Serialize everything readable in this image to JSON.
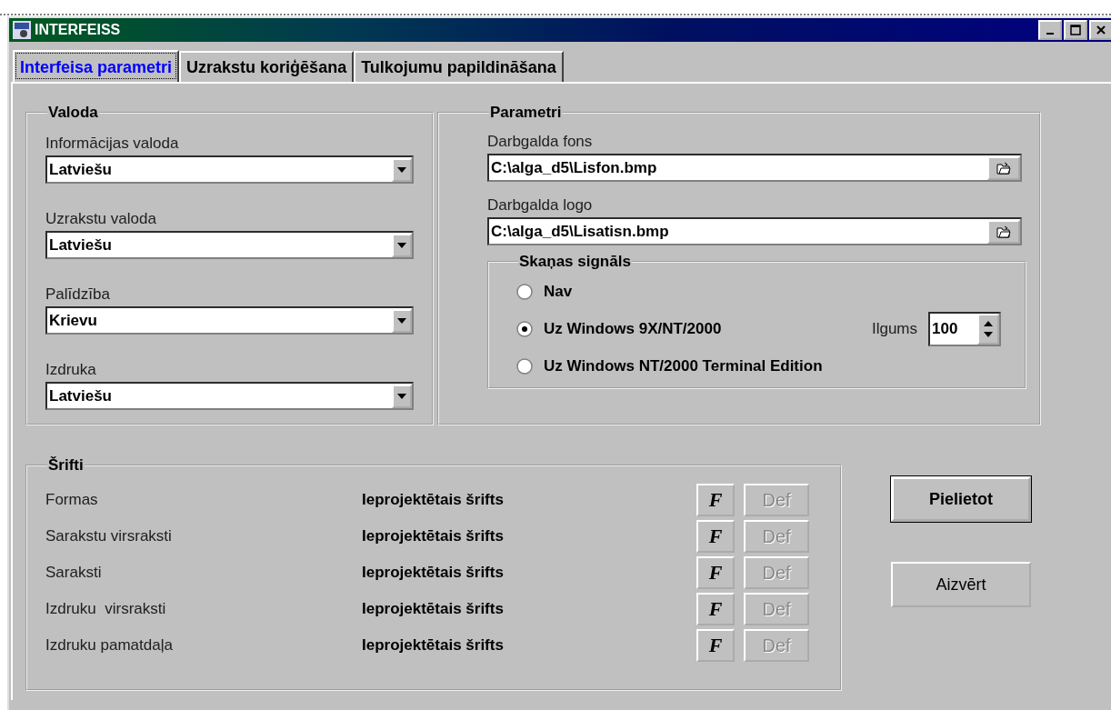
{
  "window": {
    "title": "INTERFEISS"
  },
  "tabs": [
    {
      "label": "Interfeisa parametri",
      "selected": true
    },
    {
      "label": "Uzrakstu koriģēšana",
      "selected": false
    },
    {
      "label": "Tulkojumu papildināšana",
      "selected": false
    }
  ],
  "language_group": {
    "title": "Valoda",
    "fields": [
      {
        "label": "Informācijas valoda",
        "value": "Latviešu"
      },
      {
        "label": "Uzrakstu valoda",
        "value": "Latviešu"
      },
      {
        "label": "Palīdzība",
        "value": "Krievu"
      },
      {
        "label": "Izdruka",
        "value": "Latviešu"
      }
    ]
  },
  "parameters_group": {
    "title": "Parametri",
    "files": [
      {
        "label": "Darbgalda fons",
        "value": "C:\\alga_d5\\Lisfon.bmp"
      },
      {
        "label": "Darbgalda logo",
        "value": "C:\\alga_d5\\Lisatisn.bmp"
      }
    ],
    "sound": {
      "title": "Skaņas signāls",
      "options": [
        {
          "label": "Nav",
          "selected": false
        },
        {
          "label": "Uz Windows 9X/NT/2000",
          "selected": true
        },
        {
          "label": "Uz Windows NT/2000 Terminal Edition",
          "selected": false
        }
      ],
      "duration": {
        "label": "Ilgums",
        "value": "100"
      }
    }
  },
  "fonts_group": {
    "title": "Šrifti",
    "rows": [
      {
        "name": "Formas",
        "font": "Ieprojektētais šrifts",
        "font_button": "F",
        "def_button": "Def",
        "disabled": true
      },
      {
        "name": "Sarakstu virsraksti",
        "font": "Ieprojektētais šrifts",
        "font_button": "F",
        "def_button": "Def",
        "disabled": true
      },
      {
        "name": "Saraksti",
        "font": "Ieprojektētais šrifts",
        "font_button": "F",
        "def_button": "Def",
        "disabled": true
      },
      {
        "name": "Izdruku  virsraksti",
        "font": "Ieprojektētais šrifts",
        "font_button": "F",
        "def_button": "Def",
        "disabled": true
      },
      {
        "name": "Izdruku pamatdaļa",
        "font": "Ieprojektētais šrifts",
        "font_button": "F",
        "def_button": "Def",
        "disabled": true
      }
    ]
  },
  "buttons": [
    {
      "label": "Pielietot",
      "default": true
    },
    {
      "label": "Aizvērt",
      "default": false
    }
  ]
}
